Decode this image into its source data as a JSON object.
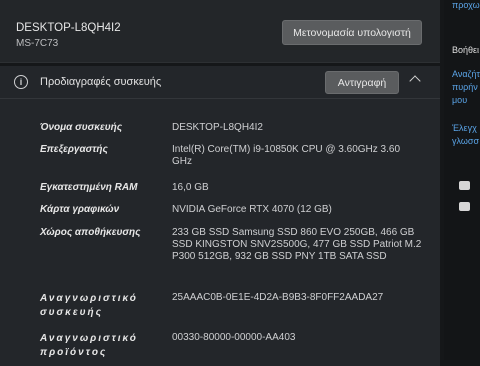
{
  "device": {
    "name": "DESKTOP-L8QH4I2",
    "model": "MS-7C73",
    "rename_button": "Μετονομασία υπολογιστή"
  },
  "specs": {
    "title": "Προδιαγραφές συσκευής",
    "copy_button": "Αντιγραφή",
    "rows": [
      {
        "label": "Όνομα συσκευής",
        "value": "DESKTOP-L8QH4I2"
      },
      {
        "label": "Επεξεργαστής",
        "value": "Intel(R) Core(TM) i9-10850K CPU @ 3.60GHz 3.60 GHz"
      },
      {
        "label": "Εγκατεστημένη RAM",
        "value": "16,0 GB"
      },
      {
        "label": "Κάρτα γραφικών",
        "value": "NVIDIA GeForce RTX 4070 (12 GB)"
      },
      {
        "label": "Χώρος αποθήκευσης",
        "value": "233 GB SSD Samsung SSD 860 EVO 250GB, 466 GB SSD KINGSTON SNV2S500G, 477 GB SSD Patriot M.2 P300 512GB, 932 GB SSD PNY 1TB SATA SSD"
      },
      {
        "label": "Αναγνωριστικό συσκευής",
        "value": "25AAAC0B-0E1E-4D2A-B9B3-8F0FF2AADA27"
      },
      {
        "label": "Αναγνωριστικό προϊόντος",
        "value": "00330-80000-00000-AA403"
      }
    ]
  },
  "right_pane": {
    "top_link": "προχωρ",
    "heading": "Βοήθει",
    "link1": "Αναζήτ πυρήν μου",
    "link2": "Έλεγχ γλωσσ"
  }
}
